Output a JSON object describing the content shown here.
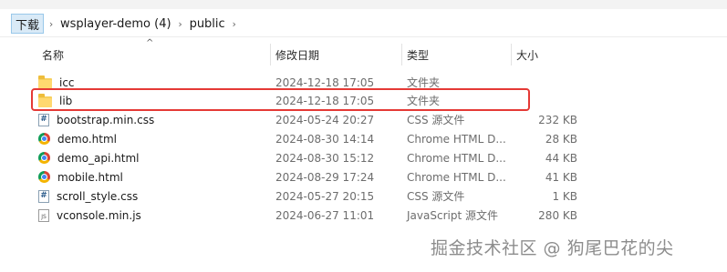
{
  "breadcrumb": {
    "items": [
      "下载",
      "wsplayer-demo (4)",
      "public"
    ],
    "separator": "›"
  },
  "columns": {
    "name": "名称",
    "date": "修改日期",
    "type": "类型",
    "size": "大小"
  },
  "files": [
    {
      "name": "icc",
      "date": "2024-12-18 17:05",
      "type": "文件夹",
      "size": "",
      "icon": "folder-icon"
    },
    {
      "name": "lib",
      "date": "2024-12-18 17:05",
      "type": "文件夹",
      "size": "",
      "icon": "folder-icon",
      "highlighted": true
    },
    {
      "name": "bootstrap.min.css",
      "date": "2024-05-24 20:27",
      "type": "CSS 源文件",
      "size": "232 KB",
      "icon": "css-file-icon"
    },
    {
      "name": "demo.html",
      "date": "2024-08-30 14:14",
      "type": "Chrome HTML D...",
      "size": "28 KB",
      "icon": "chrome-html-icon"
    },
    {
      "name": "demo_api.html",
      "date": "2024-08-30 15:12",
      "type": "Chrome HTML D...",
      "size": "44 KB",
      "icon": "chrome-html-icon"
    },
    {
      "name": "mobile.html",
      "date": "2024-08-29 17:24",
      "type": "Chrome HTML D...",
      "size": "41 KB",
      "icon": "chrome-html-icon"
    },
    {
      "name": "scroll_style.css",
      "date": "2024-05-27 20:15",
      "type": "CSS 源文件",
      "size": "1 KB",
      "icon": "css-file-icon"
    },
    {
      "name": "vconsole.min.js",
      "date": "2024-06-27 11:01",
      "type": "JavaScript 源文件",
      "size": "280 KB",
      "icon": "js-file-icon"
    }
  ],
  "colors": {
    "highlight": "#e53935",
    "breadcrumb_active_bg": "#d9eaf7",
    "folder": "#ffd86f"
  },
  "watermark": "掘金技术社区 @ 狗尾巴花的尖"
}
